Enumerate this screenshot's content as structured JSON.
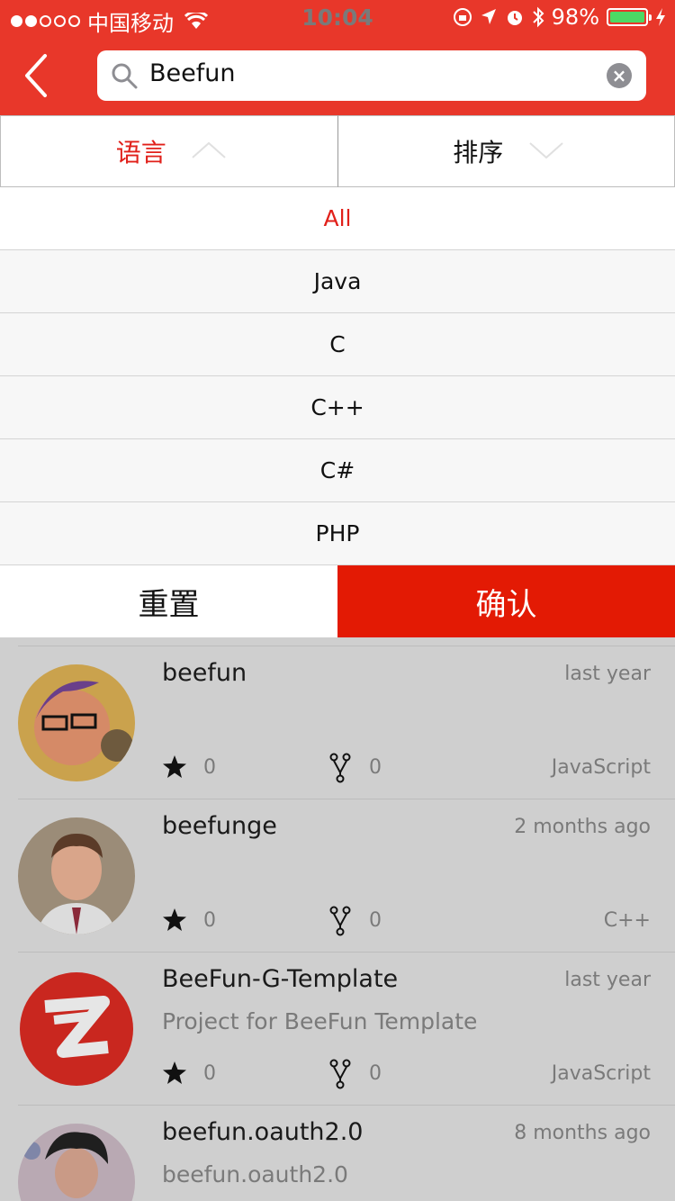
{
  "statusbar": {
    "carrier": "中国移动",
    "time": "10:04",
    "battery": "98%"
  },
  "search": {
    "value": "Beefun"
  },
  "tabs": {
    "language": "语言",
    "sort": "排序"
  },
  "dropdown": {
    "options": [
      "All",
      "Java",
      "C",
      "C++",
      "C#",
      "PHP"
    ],
    "selected": "All"
  },
  "actions": {
    "reset": "重置",
    "confirm": "确认"
  },
  "results": [
    {
      "name": "beefun",
      "description": "",
      "time": "last year",
      "stars": "0",
      "forks": "0",
      "language": "JavaScript"
    },
    {
      "name": "beefunge",
      "description": "",
      "time": "2 months ago",
      "stars": "0",
      "forks": "0",
      "language": "C++"
    },
    {
      "name": "BeeFun-G-Template",
      "description": "Project for BeeFun Template",
      "time": "last year",
      "stars": "0",
      "forks": "0",
      "language": "JavaScript"
    },
    {
      "name": "beefun.oauth2.0",
      "description": "beefun.oauth2.0",
      "time": "8 months ago",
      "stars": "",
      "forks": "",
      "language": ""
    }
  ],
  "colors": {
    "brand": "#e8372a",
    "accent": "#e1201a",
    "confirm": "#e31a04",
    "overlay": "#cfcfcf"
  },
  "icons": [
    "back-arrow-icon",
    "search-icon",
    "clear-icon",
    "chevron-up-icon",
    "chevron-down-icon",
    "star-icon",
    "fork-icon"
  ]
}
